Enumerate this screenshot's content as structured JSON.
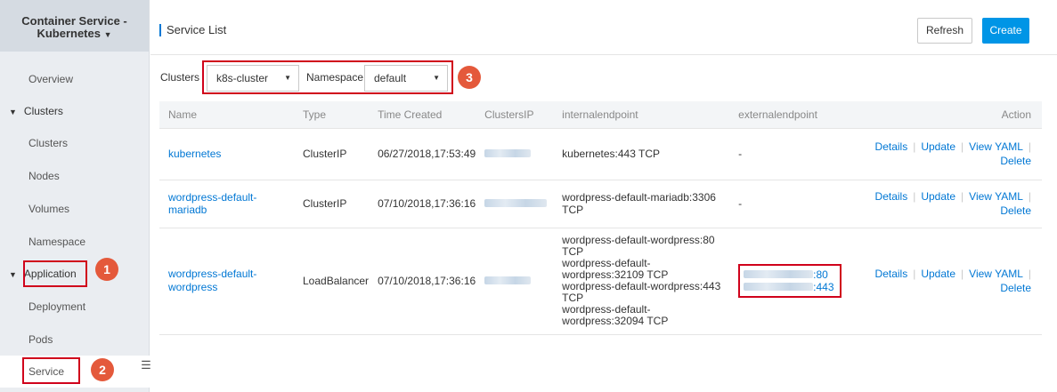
{
  "sidebar": {
    "title_line1": "Container Service -",
    "title_line2": "Kubernetes",
    "items": [
      {
        "label": "Overview"
      },
      {
        "label": "Clusters"
      },
      {
        "label": "Clusters"
      },
      {
        "label": "Nodes"
      },
      {
        "label": "Volumes"
      },
      {
        "label": "Namespace"
      },
      {
        "label": "Application"
      },
      {
        "label": "Deployment"
      },
      {
        "label": "Pods"
      },
      {
        "label": "Service"
      }
    ]
  },
  "badges": [
    "1",
    "2",
    "3"
  ],
  "header": {
    "title": "Service List",
    "refresh_label": "Refresh",
    "create_label": "Create"
  },
  "filters": {
    "clusters_label": "Clusters",
    "clusters_value": "k8s-cluster",
    "namespace_label": "Namespace",
    "namespace_value": "default"
  },
  "table": {
    "columns": [
      "Name",
      "Type",
      "Time Created",
      "ClustersIP",
      "internalendpoint",
      "externalendpoint",
      "Action"
    ],
    "rows": [
      {
        "name": "kubernetes",
        "type": "ClusterIP",
        "time": "06/27/2018,17:53:49",
        "internal": [
          "kubernetes:443 TCP"
        ],
        "external": "-"
      },
      {
        "name": "wordpress-default-mariadb",
        "type": "ClusterIP",
        "time": "07/10/2018,17:36:16",
        "internal": [
          "wordpress-default-mariadb:3306 TCP"
        ],
        "external": "-"
      },
      {
        "name": "wordpress-default-wordpress",
        "type": "LoadBalancer",
        "time": "07/10/2018,17:36:16",
        "internal": [
          "wordpress-default-wordpress:80 TCP",
          "wordpress-default-wordpress:32109 TCP",
          "wordpress-default-wordpress:443 TCP",
          "wordpress-default-wordpress:32094 TCP"
        ],
        "external_ports": [
          ":80",
          ":443"
        ]
      }
    ],
    "actions": {
      "details": "Details",
      "update": "Update",
      "view_yaml": "View YAML",
      "delete": "Delete"
    }
  },
  "colors": {
    "accent": "#0077d4",
    "create_bg": "#0095e6",
    "highlight": "#d0021b",
    "badge": "#e4593b"
  }
}
